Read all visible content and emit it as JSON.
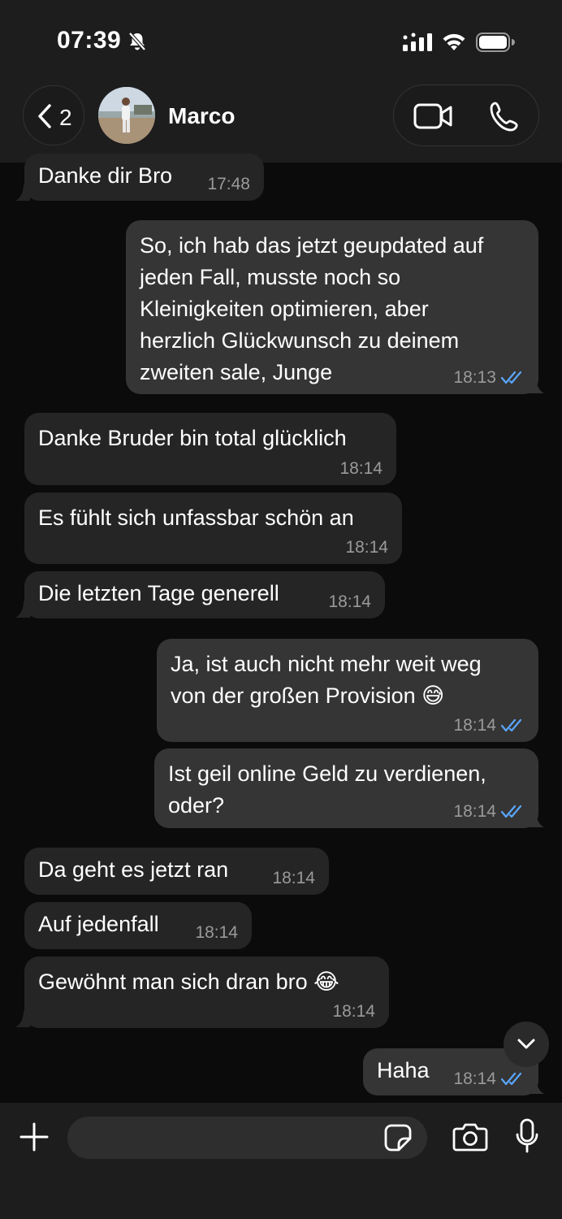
{
  "status_bar": {
    "time": "07:39"
  },
  "header": {
    "back_count": "2",
    "contact_name": "Marco"
  },
  "messages": [
    {
      "direction": "in",
      "text": "Danke dir Bro",
      "time": "17:48"
    },
    {
      "direction": "out",
      "lines": [
        "So, ich hab das jetzt geupdated auf",
        "jeden Fall, musste noch so",
        "Kleinigkeiten optimieren, aber",
        "herzlich Glückwunsch zu deinem",
        "zweiten sale, Junge"
      ],
      "time": "18:13",
      "read": true
    },
    {
      "direction": "in",
      "text": "Danke Bruder bin total glücklich",
      "time": "18:14"
    },
    {
      "direction": "in",
      "text": "Es fühlt sich unfassbar schön an",
      "time": "18:14"
    },
    {
      "direction": "in",
      "text": "Die letzten Tage generell",
      "time": "18:14"
    },
    {
      "direction": "out",
      "lines": [
        "Ja, ist auch nicht mehr weit weg",
        "von der großen Provision 😅"
      ],
      "time": "18:14",
      "read": true
    },
    {
      "direction": "out",
      "lines": [
        "Ist geil online Geld zu verdienen,",
        "oder?"
      ],
      "time": "18:14",
      "read": true
    },
    {
      "direction": "in",
      "text": "Da geht es jetzt ran",
      "time": "18:14"
    },
    {
      "direction": "in",
      "text": "Auf jedenfall",
      "time": "18:14"
    },
    {
      "direction": "in",
      "text": "Gewöhnt man sich dran bro 😂",
      "time": "18:14"
    },
    {
      "direction": "out",
      "text": "Haha",
      "time": "18:14",
      "read": true
    }
  ],
  "input": {
    "value": "",
    "placeholder": ""
  },
  "colors": {
    "incoming_bubble": "#252525",
    "outgoing_bubble": "#353535",
    "read_ticks": "#5aa7ff",
    "bar_background": "#1d1d1d"
  },
  "icons": [
    "bell-slash-icon",
    "signal-icon",
    "wifi-icon",
    "battery-icon",
    "chevron-left-icon",
    "video-call-icon",
    "phone-icon",
    "chevron-down-icon",
    "plus-icon",
    "sticker-icon",
    "camera-icon",
    "microphone-icon"
  ]
}
